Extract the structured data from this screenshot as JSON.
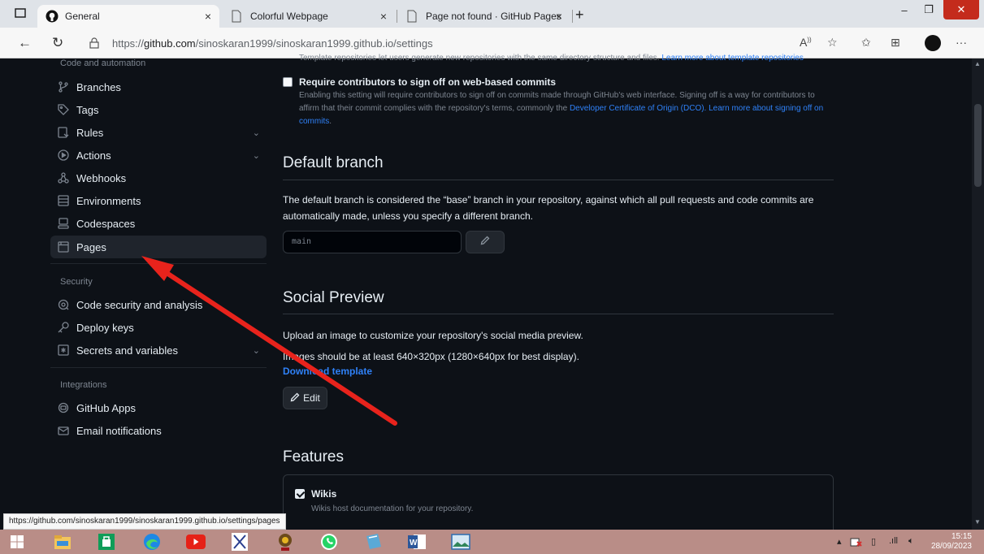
{
  "browser": {
    "tabs": [
      {
        "label": "General",
        "icon": "github-icon",
        "active": true
      },
      {
        "label": "Colorful Webpage",
        "icon": "page-icon",
        "active": false
      },
      {
        "label": "Page not found · GitHub Pages",
        "icon": "page-icon",
        "active": false
      }
    ],
    "tab_close_glyph": "×",
    "newtab_glyph": "+",
    "window_controls": {
      "minimize": "–",
      "maximize": "❐",
      "close": "✕"
    },
    "url_prefix": "https://",
    "url_host": "github.com",
    "url_path": "/sinoskaran1999/sinoskaran1999.github.io/settings",
    "toolbar_icons": [
      "read-aloud-icon",
      "favorite-icon",
      "favorites-list-icon",
      "collections-icon",
      "profile-icon",
      "more-icon"
    ],
    "more_glyph": "···",
    "status_url": "https://github.com/sinoskaran1999/sinoskaran1999.github.io/settings/pages"
  },
  "sidebar": {
    "sections": [
      {
        "title": "Code and automation",
        "items": [
          {
            "label": "Branches",
            "icon": "git-branch-icon",
            "chevron": false
          },
          {
            "label": "Tags",
            "icon": "tag-icon",
            "chevron": false
          },
          {
            "label": "Rules",
            "icon": "rules-icon",
            "chevron": true
          },
          {
            "label": "Actions",
            "icon": "actions-play-icon",
            "chevron": true
          },
          {
            "label": "Webhooks",
            "icon": "webhook-icon",
            "chevron": false
          },
          {
            "label": "Environments",
            "icon": "server-icon",
            "chevron": false
          },
          {
            "label": "Codespaces",
            "icon": "codespaces-icon",
            "chevron": false
          },
          {
            "label": "Pages",
            "icon": "browser-icon",
            "chevron": false,
            "active": true
          }
        ]
      },
      {
        "title": "Security",
        "items": [
          {
            "label": "Code security and analysis",
            "icon": "codescan-icon",
            "chevron": false
          },
          {
            "label": "Deploy keys",
            "icon": "key-icon",
            "chevron": false
          },
          {
            "label": "Secrets and variables",
            "icon": "asterisk-icon",
            "chevron": true
          }
        ]
      },
      {
        "title": "Integrations",
        "items": [
          {
            "label": "GitHub Apps",
            "icon": "apps-icon",
            "chevron": false
          },
          {
            "label": "Email notifications",
            "icon": "mail-icon",
            "chevron": false
          }
        ]
      }
    ]
  },
  "main": {
    "cut_text": "Template repositories let users generate new repositories with the same directory structure and files.",
    "cut_link": "Learn more about template repositories",
    "signoff": {
      "label": "Require contributors to sign off on web-based commits",
      "desc_1": "Enabling this setting will require contributors to sign off on commits made through GitHub's web interface. Signing off is a way for contributors to affirm that their commit complies with the repository's terms, commonly the ",
      "desc_link_1": "Developer Certificate of Origin (DCO).",
      "desc_link_2": "Learn more about signing off on commits",
      "desc_end": ".",
      "checked": false
    },
    "default_branch": {
      "heading": "Default branch",
      "description": "The default branch is considered the “base” branch in your repository, against which all pull requests and code commits are automatically made, unless you specify a different branch.",
      "value": "main",
      "edit_icon": "pencil-icon"
    },
    "social_preview": {
      "heading": "Social Preview",
      "line_1": "Upload an image to customize your repository's social media preview.",
      "line_2": "Images should be at least 640×320px (1280×640px for best display).",
      "download_link": "Download template",
      "edit_label": "Edit"
    },
    "features": {
      "heading": "Features",
      "wikis_label": "Wikis",
      "wikis_desc": "Wikis host documentation for your repository.",
      "wikis_checked": true
    }
  },
  "taskbar": {
    "apps": [
      "windows-start-icon",
      "file-explorer-icon",
      "store-icon",
      "edge-icon",
      "youtube-icon",
      "app-logo-icon",
      "emblem-icon",
      "whatsapp-icon",
      "notes-icon",
      "word-icon",
      "photos-icon"
    ],
    "time": "15:15",
    "date": "28/09/2023"
  },
  "colors": {
    "page_bg": "#0d1117",
    "link": "#2f81f7",
    "text": "#e6edf3",
    "muted": "#7d8590",
    "border": "#30363d",
    "annotation_arrow": "#e8231c",
    "taskbar": "#b98d87"
  }
}
